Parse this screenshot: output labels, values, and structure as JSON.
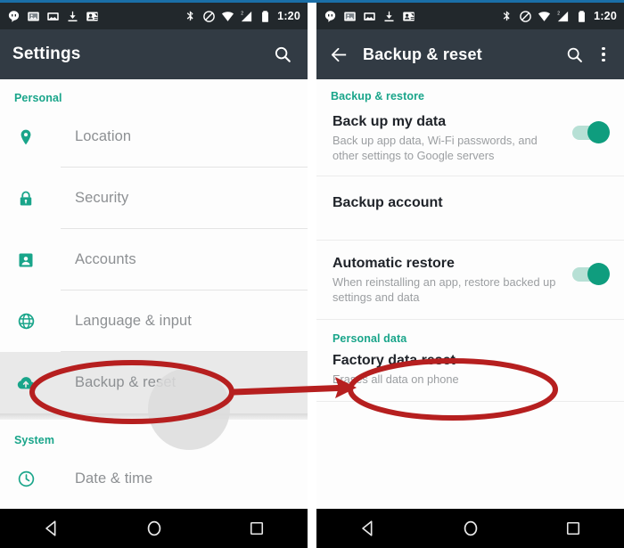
{
  "theme": {
    "accent_teal": "#19a58a",
    "switch_on": "#0f9d7e",
    "appbar_bg": "#323b44",
    "statusbar_bg": "#22282c",
    "annotation_red": "#b61f1f",
    "highlight_grey": "#e9e9e9"
  },
  "status_bar": {
    "icons_left": [
      "hangouts-icon",
      "photos-icon",
      "screenshot-icon",
      "download-icon",
      "contact-sync-icon"
    ],
    "icons_right": [
      "bluetooth-icon",
      "do-not-disturb-icon",
      "wifi-icon",
      "cellular-signal-icon",
      "battery-icon"
    ],
    "time": "1:20"
  },
  "left_panel": {
    "appbar": {
      "title": "Settings",
      "search_icon": "search-icon"
    },
    "sections": [
      {
        "header": "Personal",
        "items": [
          {
            "label": "Location",
            "icon": "location-pin-icon",
            "highlighted": false
          },
          {
            "label": "Security",
            "icon": "lock-icon",
            "highlighted": false
          },
          {
            "label": "Accounts",
            "icon": "account-badge-icon",
            "highlighted": false
          },
          {
            "label": "Language & input",
            "icon": "globe-icon",
            "highlighted": false
          },
          {
            "label": "Backup & reset",
            "icon": "backup-cloud-icon",
            "highlighted": true
          }
        ]
      },
      {
        "header": "System",
        "items": [
          {
            "label": "Date & time",
            "icon": "clock-icon",
            "highlighted": false
          }
        ]
      }
    ],
    "nav_bar": [
      "back-nav-icon",
      "home-nav-icon",
      "recents-nav-icon"
    ]
  },
  "right_panel": {
    "appbar": {
      "back_icon": "arrow-back-icon",
      "title": "Backup & reset",
      "search_icon": "search-icon",
      "overflow_icon": "overflow-menu-icon"
    },
    "sections": [
      {
        "header": "Backup & restore",
        "items": [
          {
            "title": "Back up my data",
            "subtitle": "Back up app data, Wi-Fi passwords, and other settings to Google servers",
            "toggle": "on"
          },
          {
            "title": "Backup account",
            "subtitle": "",
            "toggle": "none"
          },
          {
            "title": "Automatic restore",
            "subtitle": "When reinstalling an app, restore backed up settings and data",
            "toggle": "on"
          }
        ]
      },
      {
        "header": "Personal data",
        "items": [
          {
            "title": "Factory data reset",
            "subtitle": "Erases all data on phone",
            "toggle": "none"
          }
        ]
      }
    ],
    "nav_bar": [
      "back-nav-icon",
      "home-nav-icon",
      "recents-nav-icon"
    ]
  },
  "annotations": {
    "left_ellipse_target": "Backup & reset",
    "right_ellipse_target": "Factory data reset",
    "arrow": "points from Backup & reset row to Factory data reset row"
  }
}
